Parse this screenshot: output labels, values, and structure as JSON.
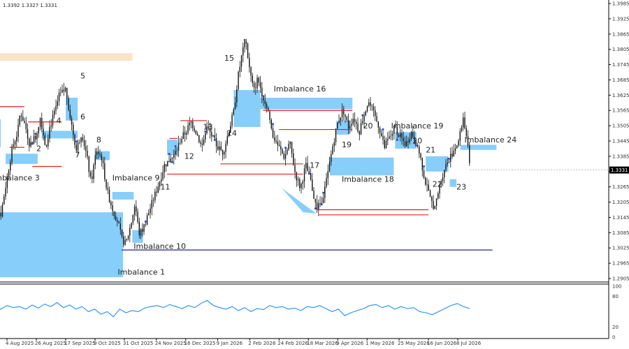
{
  "chart_data": {
    "type": "candlestick",
    "ohlc_header": "1.3392 1.3327 1.3331",
    "price_axis": {
      "ticks": [
        "1.3985",
        "1.3925",
        "1.3865",
        "1.3805",
        "1.3745",
        "1.3685",
        "1.3625",
        "1.3565",
        "1.3505",
        "1.3445",
        "1.3385",
        "1.3325",
        "1.3265",
        "1.3205",
        "1.3145",
        "1.3085",
        "1.3025",
        "1.2965",
        "1.2905"
      ],
      "range": [
        1.2905,
        1.3985
      ],
      "current_price": "1.3331"
    },
    "date_axis": {
      "ticks": [
        "4 Aug 2025",
        "26 Aug 2025",
        "17 Sep 2025",
        "9 Oct 2025",
        "31 Oct 2025",
        "24 Nov 2025",
        "16 Dec 2025",
        "9 Jan 2026",
        "2 Feb 2026",
        "24 Feb 2026",
        "18 Mar 2026",
        "9 Apr 2026",
        "1 May 2026",
        "25 May 2026",
        "16 Jun 2026",
        "8 Jul 2026"
      ]
    },
    "price_path": [
      [
        "2025-07-21",
        1.342
      ],
      [
        "2025-07-24",
        1.331
      ],
      [
        "2025-07-28",
        1.32
      ],
      [
        "2025-07-30",
        1.3145
      ],
      [
        "2025-08-04",
        1.33
      ],
      [
        "2025-08-08",
        1.342
      ],
      [
        "2025-08-12",
        1.348
      ],
      [
        "2025-08-14",
        1.356
      ],
      [
        "2025-08-18",
        1.35
      ],
      [
        "2025-08-21",
        1.343
      ],
      [
        "2025-08-26",
        1.347
      ],
      [
        "2025-08-29",
        1.354
      ],
      [
        "2025-09-02",
        1.342
      ],
      [
        "2025-09-05",
        1.35
      ],
      [
        "2025-09-09",
        1.356
      ],
      [
        "2025-09-12",
        1.362
      ],
      [
        "2025-09-17",
        1.365
      ],
      [
        "2025-09-21",
        1.352
      ],
      [
        "2025-09-25",
        1.341
      ],
      [
        "2025-09-29",
        1.348
      ],
      [
        "2025-10-03",
        1.338
      ],
      [
        "2025-10-06",
        1.328
      ],
      [
        "2025-10-10",
        1.341
      ],
      [
        "2025-10-14",
        1.338
      ],
      [
        "2025-10-18",
        1.325
      ],
      [
        "2025-10-22",
        1.318
      ],
      [
        "2025-10-26",
        1.313
      ],
      [
        "2025-10-29",
        1.306
      ],
      [
        "2025-11-01",
        1.304
      ],
      [
        "2025-11-05",
        1.312
      ],
      [
        "2025-11-08",
        1.32
      ],
      [
        "2025-11-11",
        1.308
      ],
      [
        "2025-11-14",
        1.31
      ],
      [
        "2025-11-18",
        1.316
      ],
      [
        "2025-11-22",
        1.322
      ],
      [
        "2025-11-26",
        1.328
      ],
      [
        "2025-11-30",
        1.335
      ],
      [
        "2025-12-04",
        1.337
      ],
      [
        "2025-12-08",
        1.339
      ],
      [
        "2025-12-12",
        1.345
      ],
      [
        "2025-12-16",
        1.348
      ],
      [
        "2025-12-20",
        1.352
      ],
      [
        "2025-12-24",
        1.348
      ],
      [
        "2025-12-28",
        1.342
      ],
      [
        "2026-01-01",
        1.35
      ],
      [
        "2026-01-05",
        1.346
      ],
      [
        "2026-01-09",
        1.342
      ],
      [
        "2026-01-13",
        1.34
      ],
      [
        "2026-01-17",
        1.348
      ],
      [
        "2026-01-21",
        1.356
      ],
      [
        "2026-01-24",
        1.369
      ],
      [
        "2026-01-27",
        1.378
      ],
      [
        "2026-01-30",
        1.384
      ],
      [
        "2026-02-02",
        1.372
      ],
      [
        "2026-02-05",
        1.364
      ],
      [
        "2026-02-08",
        1.369
      ],
      [
        "2026-02-12",
        1.362
      ],
      [
        "2026-02-16",
        1.356
      ],
      [
        "2026-02-19",
        1.347
      ],
      [
        "2026-02-24",
        1.342
      ],
      [
        "2026-02-28",
        1.338
      ],
      [
        "2026-03-04",
        1.344
      ],
      [
        "2026-03-08",
        1.332
      ],
      [
        "2026-03-12",
        1.326
      ],
      [
        "2026-03-16",
        1.335
      ],
      [
        "2026-03-20",
        1.328
      ],
      [
        "2026-03-24",
        1.318
      ],
      [
        "2026-03-28",
        1.32
      ],
      [
        "2026-04-01",
        1.33
      ],
      [
        "2026-04-05",
        1.342
      ],
      [
        "2026-04-09",
        1.352
      ],
      [
        "2026-04-13",
        1.357
      ],
      [
        "2026-04-17",
        1.35
      ],
      [
        "2026-04-21",
        1.354
      ],
      [
        "2026-04-25",
        1.348
      ],
      [
        "2026-04-29",
        1.356
      ],
      [
        "2026-05-02",
        1.36
      ],
      [
        "2026-05-06",
        1.355
      ],
      [
        "2026-05-10",
        1.35
      ],
      [
        "2026-05-14",
        1.342
      ],
      [
        "2026-05-18",
        1.346
      ],
      [
        "2026-05-22",
        1.35
      ],
      [
        "2026-05-26",
        1.346
      ],
      [
        "2026-05-30",
        1.343
      ],
      [
        "2026-06-03",
        1.348
      ],
      [
        "2026-06-07",
        1.344
      ],
      [
        "2026-06-10",
        1.338
      ],
      [
        "2026-06-13",
        1.33
      ],
      [
        "2026-06-17",
        1.322
      ],
      [
        "2026-06-21",
        1.318
      ],
      [
        "2026-06-24",
        1.326
      ],
      [
        "2026-06-28",
        1.334
      ],
      [
        "2026-07-02",
        1.338
      ],
      [
        "2026-07-06",
        1.342
      ],
      [
        "2026-07-09",
        1.345
      ],
      [
        "2026-07-12",
        1.354
      ],
      [
        "2026-07-15",
        1.345
      ],
      [
        "2026-07-17",
        1.3331
      ]
    ],
    "rsi": {
      "levels": [
        "100",
        "80",
        "20",
        "0"
      ],
      "values": [
        52,
        58,
        55,
        62,
        58,
        60,
        55,
        63,
        57,
        65,
        60,
        68,
        58,
        63,
        55,
        60,
        50,
        55,
        45,
        50,
        40,
        55,
        48,
        52,
        50,
        57,
        60,
        62,
        58,
        64,
        60,
        56,
        62,
        58,
        66,
        72,
        62,
        58,
        55,
        60,
        52,
        58,
        50,
        56,
        54,
        62,
        58,
        60,
        55,
        57,
        52,
        60,
        58,
        62,
        56,
        50,
        55,
        42,
        48,
        52,
        56,
        62,
        64,
        58,
        62,
        55,
        60,
        56,
        58,
        50,
        48,
        44,
        50,
        56,
        62,
        66,
        60,
        56
      ]
    },
    "imbalance_zones": [
      {
        "start": "2025-07-21",
        "end": "2025-10-30",
        "low": 1.291,
        "high": 1.3165,
        "color": "#87cefa"
      },
      {
        "start": "2025-07-21",
        "end": "2025-11-06",
        "low": 1.376,
        "high": 1.379,
        "color": "#fbe3c8"
      },
      {
        "start": "2025-08-03",
        "end": "2025-08-27",
        "low": 1.3355,
        "high": 1.3395,
        "color": "#87cefa"
      },
      {
        "start": "2025-07-21",
        "end": "2025-07-27",
        "low": 1.342,
        "high": 1.353,
        "color": "#87cefa"
      },
      {
        "start": "2025-08-30",
        "end": "2025-09-26",
        "low": 1.3455,
        "high": 1.3485,
        "color": "#87cefa"
      },
      {
        "start": "2025-09-17",
        "end": "2025-09-26",
        "low": 1.3525,
        "high": 1.3615,
        "color": "#87cefa"
      },
      {
        "start": "2025-10-09",
        "end": "2025-10-20",
        "low": 1.337,
        "high": 1.3405,
        "color": "#87cefa"
      },
      {
        "start": "2025-10-22",
        "end": "2025-11-07",
        "low": 1.3215,
        "high": 1.3245,
        "color": "#87cefa"
      },
      {
        "start": "2025-11-06",
        "end": "2025-11-14",
        "low": 1.3045,
        "high": 1.3095,
        "color": "#87cefa"
      },
      {
        "start": "2025-12-02",
        "end": "2025-12-10",
        "low": 1.339,
        "high": 1.345,
        "color": "#87cefa"
      },
      {
        "start": "2026-01-21",
        "end": "2026-02-10",
        "low": 1.35,
        "high": 1.3645,
        "color": "#87cefa"
      },
      {
        "start": "2026-02-09",
        "end": "2026-04-20",
        "low": 1.357,
        "high": 1.3615,
        "color": "#87cefa"
      },
      {
        "start": "2026-04-08",
        "end": "2026-04-18",
        "low": 1.347,
        "high": 1.3525,
        "color": "#87cefa"
      },
      {
        "start": "2026-04-03",
        "end": "2026-05-21",
        "low": 1.331,
        "high": 1.338,
        "color": "#87cefa"
      },
      {
        "start": "2026-05-22",
        "end": "2026-06-07",
        "low": 1.3415,
        "high": 1.348,
        "color": "#87cefa"
      },
      {
        "start": "2026-06-14",
        "end": "2026-07-01",
        "low": 1.3325,
        "high": 1.3385,
        "color": "#87cefa"
      },
      {
        "start": "2026-07-02",
        "end": "2026-07-07",
        "low": 1.3265,
        "high": 1.3295,
        "color": "#87cefa"
      },
      {
        "start": "2026-07-10",
        "end": "2026-08-06",
        "low": 1.341,
        "high": 1.343,
        "color": "#87cefa"
      }
    ],
    "level_lines": [
      {
        "start": "2025-07-21",
        "end": "2025-08-17",
        "price": 1.358,
        "color": "#e02020"
      },
      {
        "start": "2025-08-06",
        "end": "2025-08-17",
        "price": 1.342,
        "color": "#e02020"
      },
      {
        "start": "2025-08-20",
        "end": "2025-09-14",
        "price": 1.352,
        "color": "#e02020"
      },
      {
        "start": "2025-08-23",
        "end": "2025-09-14",
        "price": 1.3345,
        "color": "#e02020"
      },
      {
        "start": "2025-12-04",
        "end": "2025-12-10",
        "price": 1.3455,
        "color": "#e02020"
      },
      {
        "start": "2025-12-12",
        "end": "2026-01-01",
        "price": 1.3525,
        "color": "#e02020"
      },
      {
        "start": "2025-12-02",
        "end": "2026-03-14",
        "price": 1.3315,
        "color": "#e02020"
      },
      {
        "start": "2026-01-11",
        "end": "2026-03-14",
        "price": 1.3355,
        "color": "#e02020"
      },
      {
        "start": "2026-02-12",
        "end": "2026-04-20",
        "price": 1.3565,
        "color": "#e02020"
      },
      {
        "start": "2026-02-24",
        "end": "2026-04-20",
        "price": 1.349,
        "color": "#e02020"
      },
      {
        "start": "2026-03-24",
        "end": "2026-06-16",
        "price": 1.3175,
        "color": "#e02020"
      },
      {
        "start": "2026-03-26",
        "end": "2026-06-16",
        "price": 1.3155,
        "color": "#e02020"
      },
      {
        "start": "2025-10-29",
        "end": "2026-08-03",
        "price": 1.3017,
        "color": "#2020a0"
      }
    ],
    "wedge": [
      [
        "2026-02-26",
        1.326
      ],
      [
        "2026-03-24",
        1.316
      ],
      [
        "2026-03-14",
        1.3165
      ]
    ],
    "labels": [
      {
        "text": "Imbalance 1",
        "date": "2025-10-26",
        "price": 1.292,
        "size": "imb"
      },
      {
        "text": "Imbalance 3",
        "date": "2025-07-24",
        "price": 1.329,
        "size": "imb"
      },
      {
        "text": "Imbalance 9",
        "date": "2025-10-22",
        "price": 1.329,
        "size": "imb"
      },
      {
        "text": "Imbalance 10",
        "date": "2025-11-07",
        "price": 1.3022,
        "size": "imb"
      },
      {
        "text": "Imbalance 16",
        "date": "2026-02-20",
        "price": 1.364,
        "size": "imb"
      },
      {
        "text": "Imbalance 18",
        "date": "2026-04-12",
        "price": 1.3285,
        "size": "imb"
      },
      {
        "text": "Imbalance 19",
        "date": "2026-05-19",
        "price": 1.3495,
        "size": "imb"
      },
      {
        "text": "Imbalance 24",
        "date": "2026-07-13",
        "price": 1.344,
        "size": "imb"
      },
      {
        "text": "2",
        "date": "2025-08-26",
        "price": 1.3405,
        "size": "num"
      },
      {
        "text": "4",
        "date": "2025-09-10",
        "price": 1.3515,
        "size": "num"
      },
      {
        "text": "5",
        "date": "2025-09-28",
        "price": 1.369,
        "size": "num"
      },
      {
        "text": "6",
        "date": "2025-09-28",
        "price": 1.353,
        "size": "num"
      },
      {
        "text": "7",
        "date": "2025-09-24",
        "price": 1.338,
        "size": "num"
      },
      {
        "text": "8",
        "date": "2025-10-10",
        "price": 1.344,
        "size": "num"
      },
      {
        "text": "11",
        "date": "2025-11-27",
        "price": 1.3255,
        "size": "num"
      },
      {
        "text": "12",
        "date": "2025-12-15",
        "price": 1.3375,
        "size": "num"
      },
      {
        "text": "13",
        "date": "2025-12-29",
        "price": 1.349,
        "size": "num"
      },
      {
        "text": "14",
        "date": "2026-01-16",
        "price": 1.3465,
        "size": "num"
      },
      {
        "text": "15",
        "date": "2026-01-14",
        "price": 1.376,
        "size": "num"
      },
      {
        "text": "17",
        "date": "2026-03-19",
        "price": 1.334,
        "size": "num"
      },
      {
        "text": "19",
        "date": "2026-04-12",
        "price": 1.342,
        "size": "num"
      },
      {
        "text": "20",
        "date": "2026-04-28",
        "price": 1.3495,
        "size": "num"
      },
      {
        "text": "20",
        "date": "2026-06-04",
        "price": 1.3435,
        "size": "num"
      },
      {
        "text": "21",
        "date": "2026-06-14",
        "price": 1.34,
        "size": "num"
      },
      {
        "text": "22",
        "date": "2026-06-19",
        "price": 1.3265,
        "size": "num"
      },
      {
        "text": "23",
        "date": "2026-07-07",
        "price": 1.3255,
        "size": "num"
      }
    ]
  }
}
